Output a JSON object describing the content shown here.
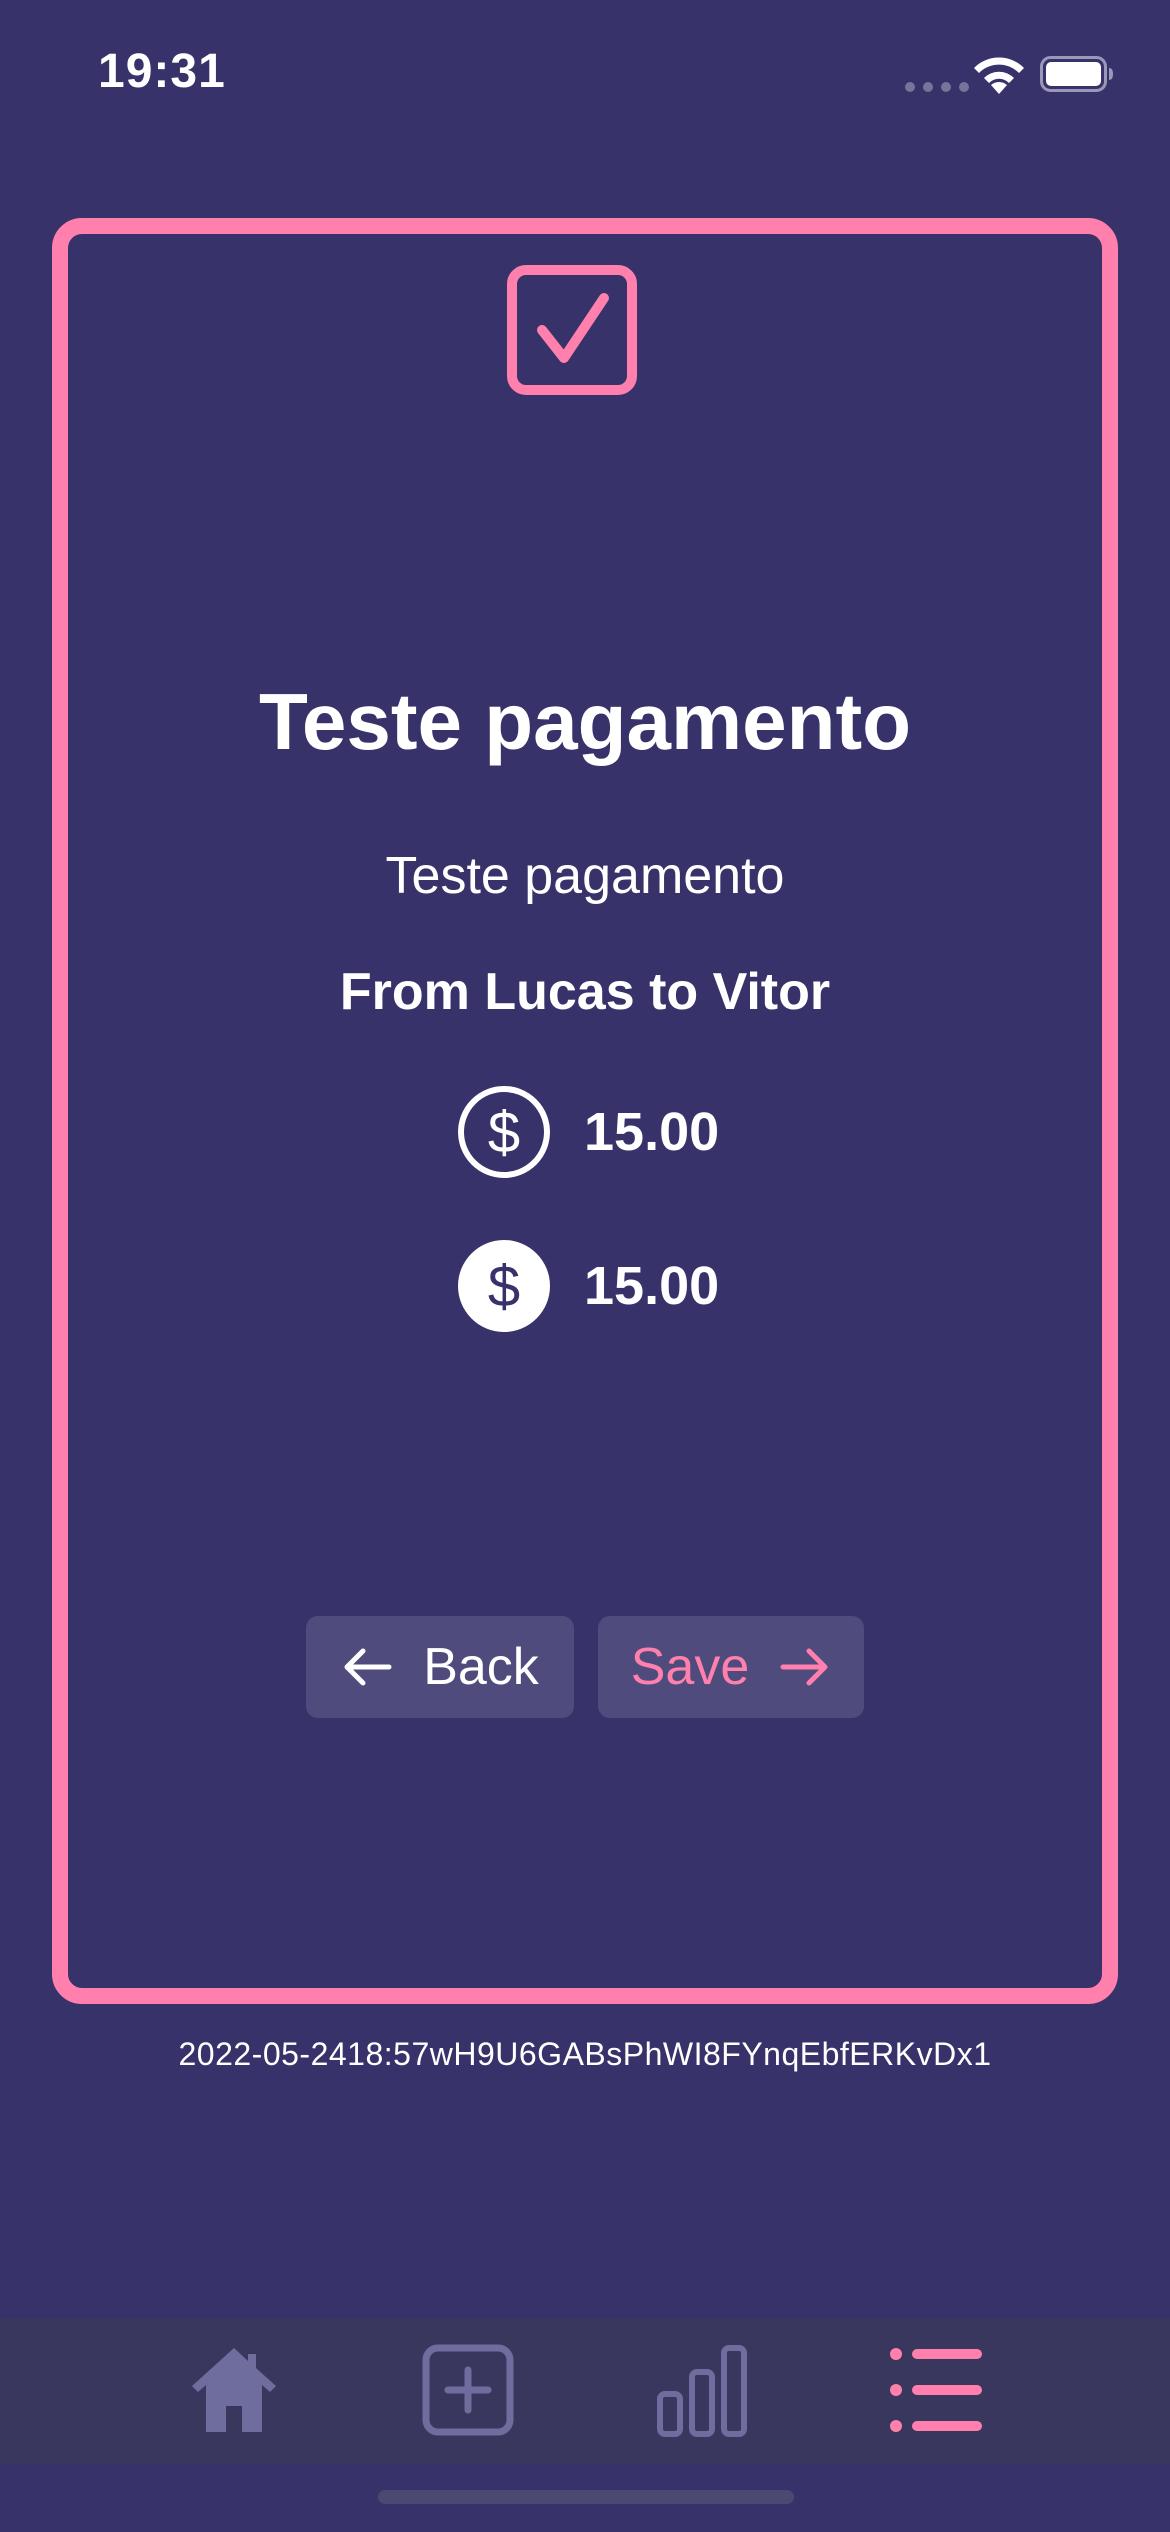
{
  "status_bar": {
    "time": "19:31",
    "signal_icon": "cellular-signal-icon",
    "wifi_icon": "wifi-icon",
    "battery_icon": "battery-icon"
  },
  "card": {
    "icon": "checkbox-checked-icon",
    "title": "Teste pagamento",
    "description": "Teste pagamento",
    "from_to": "From Lucas to Vitor",
    "amounts": [
      {
        "icon": "dollar-circle-outline-icon",
        "value": "15.00"
      },
      {
        "icon": "dollar-circle-filled-icon",
        "value": "15.00"
      }
    ],
    "back_label": "Back",
    "save_label": "Save"
  },
  "footer_id": "2022-05-2418:57wH9U6GABsPhWI8FYnqEbfERKvDx1",
  "tab_bar": {
    "tabs": [
      {
        "icon": "home-icon",
        "active": false
      },
      {
        "icon": "add-square-icon",
        "active": false
      },
      {
        "icon": "bar-chart-icon",
        "active": false
      },
      {
        "icon": "list-icon",
        "active": true
      }
    ]
  },
  "colors": {
    "background": "#37336a",
    "accent": "#ff80ad",
    "button_bg": "#4f4b7c",
    "tab_bar_bg": "#3a375e",
    "inactive_icon": "#6f6c9e",
    "text": "#ffffff"
  }
}
